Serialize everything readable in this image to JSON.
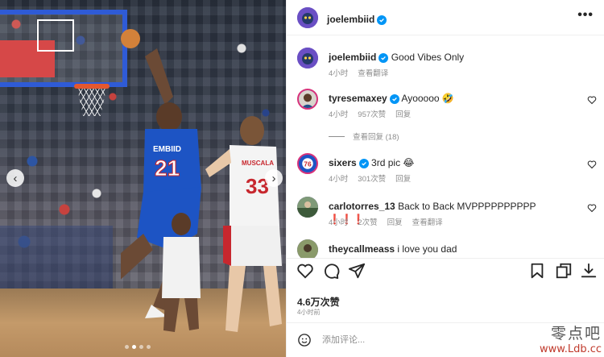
{
  "photo": {
    "jersey_left_name": "EMBIID",
    "jersey_left_number": "21",
    "jersey_right_name": "MUSCALA",
    "jersey_right_number": "33",
    "carousel_count": 4,
    "carousel_active": 1
  },
  "header": {
    "username": "joelembiid",
    "more_label": "•••"
  },
  "comments": [
    {
      "username": "joelembiid",
      "text": "Good Vibes Only",
      "time": "4小时",
      "likes": "",
      "reply": "",
      "translate": "查看翻译"
    },
    {
      "username": "tyresemaxey",
      "text": "Ayooooo 🤣",
      "time": "4小时",
      "likes": "957次赞",
      "reply": "回复",
      "translate": ""
    },
    {
      "username": "sixers",
      "text": "3rd pic 😂",
      "time": "4小时",
      "likes": "301次赞",
      "reply": "回复",
      "translate": ""
    },
    {
      "username": "carlotorres_13",
      "text": "Back to Back MVPPPPPPPPPP ❗❗❗",
      "time": "4小时",
      "likes": "2次赞",
      "reply": "回复",
      "translate": "查看翻译"
    },
    {
      "username": "theycallmeass",
      "text": "i love you dad",
      "time": "",
      "likes": "",
      "reply": "",
      "translate": ""
    }
  ],
  "view_replies": "查看回复 (18)",
  "post": {
    "likes": "4.6万次赞",
    "time": "4小时前"
  },
  "add_comment": {
    "placeholder": "添加评论..."
  },
  "watermark": {
    "cn": "零点吧",
    "url": "www.Ldb.cc"
  },
  "colors": {
    "verified": "#0095f6",
    "sixers_blue": "#1d54c4",
    "wizards_red": "#d12f2f"
  }
}
